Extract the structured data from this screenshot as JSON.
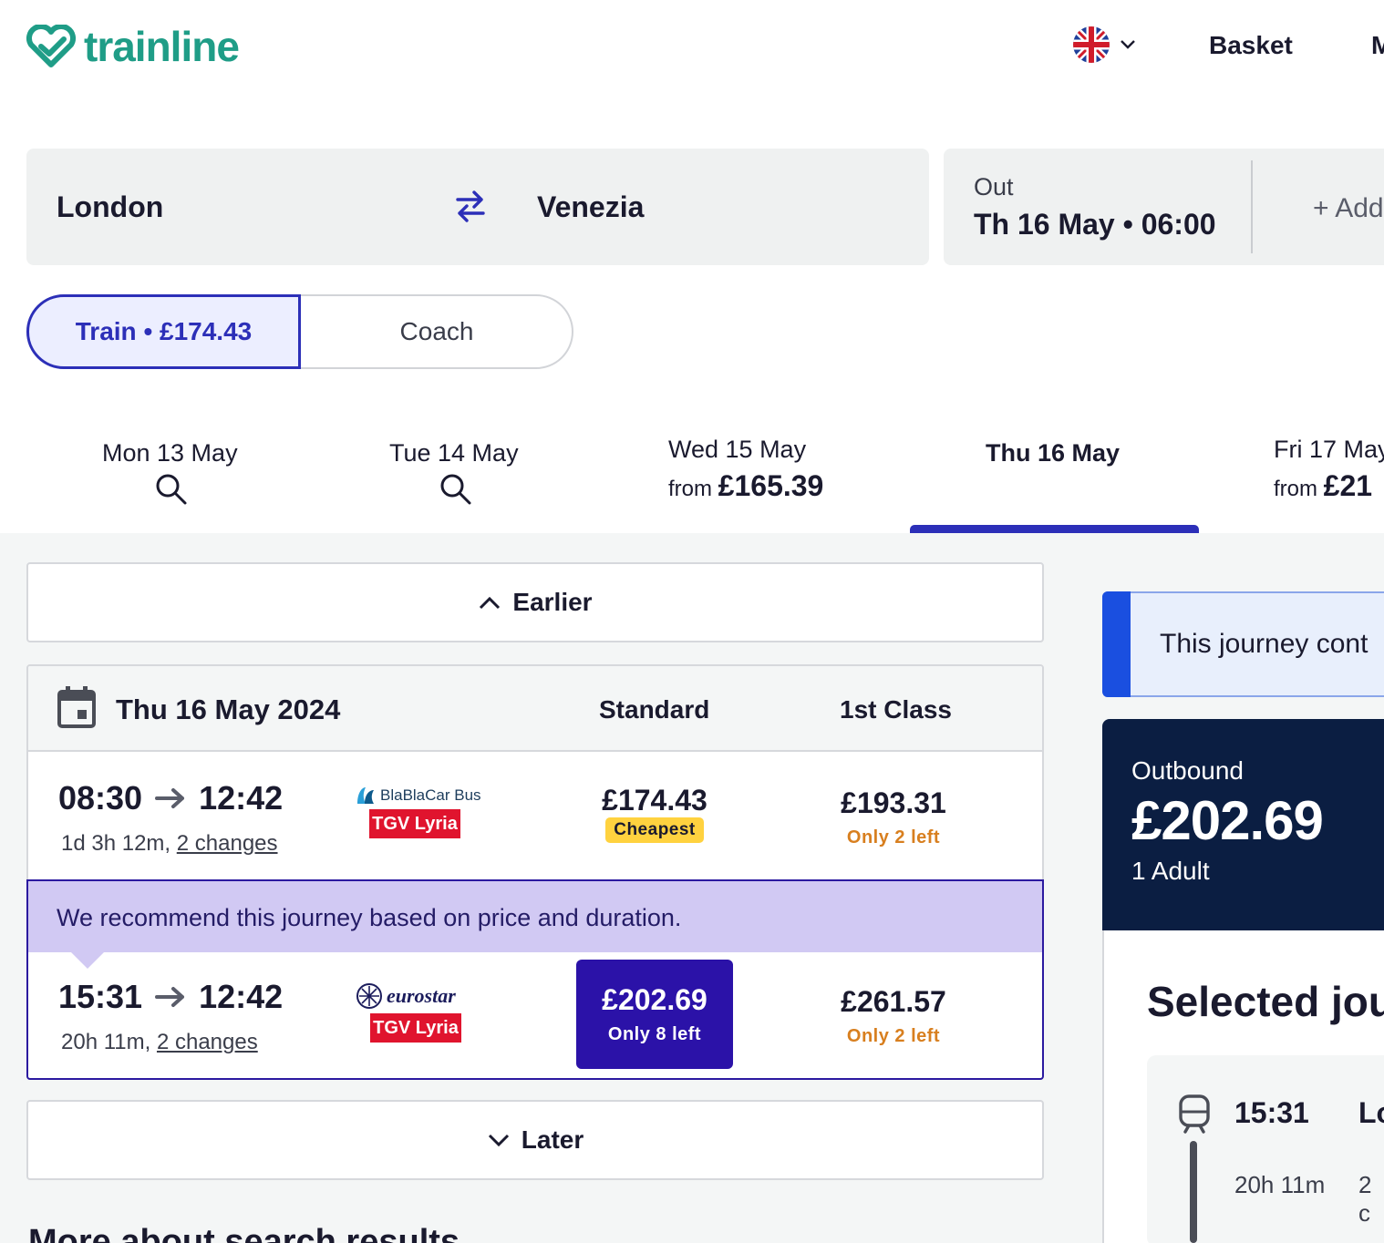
{
  "header": {
    "logo_text": "trainline",
    "basket_label": "Basket",
    "menu_partial": "M"
  },
  "search": {
    "origin": "London",
    "destination": "Venezia",
    "out_label": "Out",
    "out_value": "Th 16 May • 06:00",
    "add_return_label": "+ Add"
  },
  "modes": {
    "train_label": "Train • £174.43",
    "coach_label": "Coach"
  },
  "date_tabs": [
    {
      "label": "Mon 13 May",
      "from": "",
      "price": ""
    },
    {
      "label": "Tue 14 May",
      "from": "",
      "price": ""
    },
    {
      "label": "Wed 15 May",
      "from": "from",
      "price": "£165.39"
    },
    {
      "label": "Thu 16 May",
      "from": "",
      "price": ""
    },
    {
      "label": "Fri 17 May",
      "from": "from",
      "price": "£21"
    }
  ],
  "results": {
    "earlier_label": "Earlier",
    "later_label": "Later",
    "date_heading": "Thu 16 May 2024",
    "col_standard": "Standard",
    "col_first": "1st Class",
    "recommendation": "We recommend this journey based on price and duration.",
    "journeys": [
      {
        "depart": "08:30",
        "arrive": "12:42",
        "duration": "1d 3h 12m,",
        "changes": "2 changes",
        "carrier_top": "BlaBlaCar Bus",
        "carrier_bottom": "TGV Lyria",
        "standard_price": "£174.43",
        "standard_badge": "Cheapest",
        "first_price": "£193.31",
        "first_note": "Only 2 left"
      },
      {
        "depart": "15:31",
        "arrive": "12:42",
        "duration": "20h 11m,",
        "changes": "2 changes",
        "carrier_top": "eurostar",
        "carrier_bottom": "TGV Lyria",
        "standard_price": "£202.69",
        "standard_note": "Only 8 left",
        "first_price": "£261.57",
        "first_note": "Only 2 left"
      }
    ],
    "more_about": "More about search results"
  },
  "sidebar": {
    "notice_text": "This journey cont",
    "summary_label": "Outbound",
    "summary_price": "£202.69",
    "summary_pax": "1 Adult",
    "selected_title": "Selected jou",
    "selected_time": "15:31",
    "selected_dest": "Lo",
    "selected_duration": "20h 11m",
    "selected_changes": "2 c"
  },
  "colors": {
    "brand": "#1f9d87",
    "accent": "#2c2fb8",
    "selected": "#2b12a8",
    "recommend_bg": "#d1c9f3",
    "summary_bg": "#0b1e42",
    "warning": "#d87f1f",
    "cheapest": "#ffd23f"
  }
}
